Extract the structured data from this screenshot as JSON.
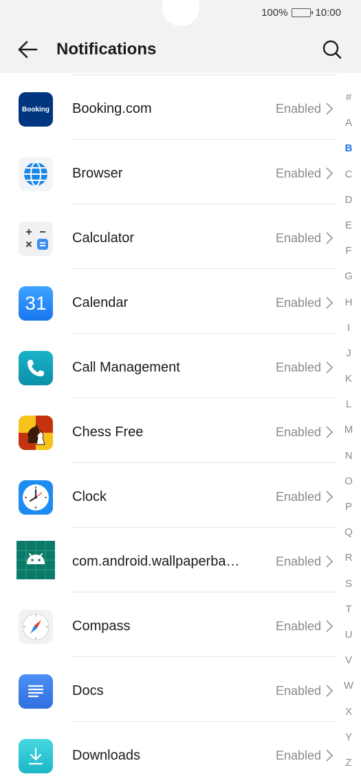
{
  "status_bar": {
    "battery": "100%",
    "battery_level": 1.0,
    "time": "10:00"
  },
  "header": {
    "title": "Notifications",
    "back_icon": "arrow-left-icon",
    "search_icon": "search-icon"
  },
  "apps": [
    {
      "name": "Booking.com",
      "status": "Enabled",
      "icon": "booking-icon",
      "icon_text": "Booking"
    },
    {
      "name": "Browser",
      "status": "Enabled",
      "icon": "browser-icon"
    },
    {
      "name": "Calculator",
      "status": "Enabled",
      "icon": "calculator-icon"
    },
    {
      "name": "Calendar",
      "status": "Enabled",
      "icon": "calendar-icon",
      "icon_text": "31"
    },
    {
      "name": "Call Management",
      "status": "Enabled",
      "icon": "phone-icon"
    },
    {
      "name": "Chess Free",
      "status": "Enabled",
      "icon": "chess-icon"
    },
    {
      "name": "Clock",
      "status": "Enabled",
      "icon": "clock-icon"
    },
    {
      "name": "com.android.wallpaperba…",
      "status": "Enabled",
      "icon": "android-icon"
    },
    {
      "name": "Compass",
      "status": "Enabled",
      "icon": "compass-icon"
    },
    {
      "name": "Docs",
      "status": "Enabled",
      "icon": "docs-icon"
    },
    {
      "name": "Downloads",
      "status": "Enabled",
      "icon": "download-icon"
    }
  ],
  "alphabet": [
    "#",
    "A",
    "B",
    "C",
    "D",
    "E",
    "F",
    "G",
    "H",
    "I",
    "J",
    "K",
    "L",
    "M",
    "N",
    "O",
    "P",
    "Q",
    "R",
    "S",
    "T",
    "U",
    "V",
    "W",
    "X",
    "Y",
    "Z"
  ],
  "alphabet_active": "B",
  "colors": {
    "accent": "#1a73e8",
    "status_text": "#8a8a8a"
  }
}
